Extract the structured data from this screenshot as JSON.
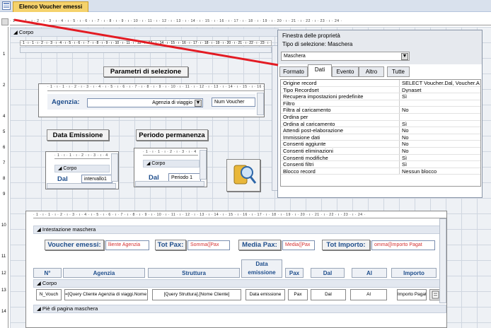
{
  "tab_title": "Elenco Voucher emessi",
  "ruler_text": "· 1 · ı · 1 · ı · 2 · ı · 3 · ı · 4 · ı · 5 · ı · 6 · ı · 7 · ı · 8 · ı · 9 · ı · 10 · ı · 11 · ı · 12 · ı · 13 · ı · 14 · ı · 15 · ı · 16 · ı · 17 · ı · 18 · ı · 19 · ı · 20 · ı · 21 · ı · 22 · ı · 23 · ı · 24 ·",
  "main_section": "Corpo",
  "params_title": "Parametri di selezione",
  "agenzia": {
    "label": "Agenzia:",
    "value": "Agenzia di viaggio",
    "num_voucher": "Num Voucher"
  },
  "data_emissione": {
    "title": "Data Emissione",
    "corpo": "Corpo",
    "dal_label": "Dal",
    "dal_value": "intervallo1"
  },
  "periodo": {
    "title": "Periodo permanenza",
    "corpo": "Corpo",
    "dal_label": "Dal",
    "dal_value": "Periodo 1"
  },
  "sub_form": {
    "intestazione": "Intestazione maschera",
    "voucher_label": "Voucher emessi:",
    "voucher_value": "lliente Agenzia",
    "totpax_label": "Tot Pax:",
    "totpax_value": "Somma([Pax",
    "mediapax_label": "Media Pax:",
    "mediapax_value": "Media([Pax",
    "totimporto_label": "Tot Importo:",
    "totimporto_value": "omma([Importo Pagat",
    "headers": [
      "N°",
      "Agenzia",
      "Struttura",
      "Data emissione",
      "Pax",
      "Dal",
      "Al",
      "Importo"
    ],
    "corpo": "Corpo",
    "row": [
      "N_Vouch",
      "=[Query Cliente Agenzia di viaggi.Nome Cliente]",
      "[Query  Struttura].[Nome Cliente]",
      "Data emissione",
      "Pax",
      "Dal",
      "Al",
      "Importo Pagato"
    ],
    "footer": "Piè di pagina maschera"
  },
  "properties": {
    "title": "Finestra delle proprietà",
    "selection_type": "Tipo di selezione:  Maschera",
    "dropdown_value": "Maschera",
    "tabs": [
      "Formato",
      "Dati",
      "Evento",
      "Altro",
      "Tutte"
    ],
    "active_tab": "Dati",
    "rows": [
      {
        "k": "Origine record",
        "v": "SELECT Voucher.Dal, Voucher.A"
      },
      {
        "k": "Tipo Recordset",
        "v": "Dynaset"
      },
      {
        "k": "Recupera impostazioni predefinite",
        "v": "Sì"
      },
      {
        "k": "Filtro",
        "v": ""
      },
      {
        "k": "Filtra al caricamento",
        "v": "No"
      },
      {
        "k": "Ordina per",
        "v": ""
      },
      {
        "k": "Ordina al caricamento",
        "v": "Sì"
      },
      {
        "k": "Attendi post-elaborazione",
        "v": "No"
      },
      {
        "k": "Immissione dati",
        "v": "No"
      },
      {
        "k": "Consenti aggiunte",
        "v": "No"
      },
      {
        "k": "Consenti eliminazioni",
        "v": "No"
      },
      {
        "k": "Consenti modifiche",
        "v": "Sì"
      },
      {
        "k": "Consenti filtri",
        "v": "Sì"
      },
      {
        "k": "Blocco record",
        "v": "Nessun blocco"
      }
    ]
  },
  "colors": {
    "accent_red": "#e31b23",
    "tab_active": "#f5d26c",
    "label_blue": "#1f4e8c"
  }
}
